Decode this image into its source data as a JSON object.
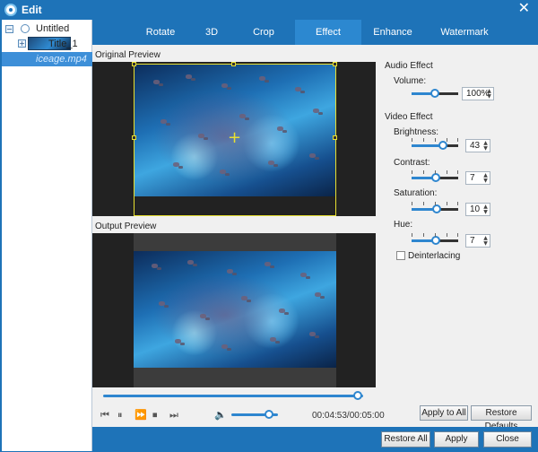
{
  "window": {
    "title": "Edit"
  },
  "tree": {
    "project": "Untitled",
    "title_item": "Title_1",
    "file_item": "iceage.mp4"
  },
  "tabs": [
    "Rotate",
    "3D",
    "Crop",
    "Effect",
    "Enhance",
    "Watermark"
  ],
  "active_tab": "Effect",
  "preview": {
    "original_label": "Original Preview",
    "output_label": "Output Preview"
  },
  "playback": {
    "time": "00:04:53/00:05:00",
    "progress": 0.98,
    "volume": 0.8
  },
  "audio_effect": {
    "header": "Audio Effect",
    "volume_label": "Volume:",
    "volume_value": "100%",
    "volume_level": 0.5
  },
  "video_effect": {
    "header": "Video Effect",
    "brightness_label": "Brightness:",
    "brightness_value": "43",
    "contrast_label": "Contrast:",
    "contrast_value": "7",
    "saturation_label": "Saturation:",
    "saturation_value": "10",
    "hue_label": "Hue:",
    "hue_value": "7",
    "deinterlacing_label": "Deinterlacing",
    "deinterlacing_checked": false
  },
  "buttons": {
    "apply_to_all": "Apply to All",
    "restore_defaults": "Restore Defaults",
    "restore_all": "Restore All",
    "apply": "Apply",
    "close": "Close"
  },
  "colors": {
    "accent": "#1e73b8",
    "slider": "#2e86cf",
    "crop_box": "#e8e030"
  }
}
